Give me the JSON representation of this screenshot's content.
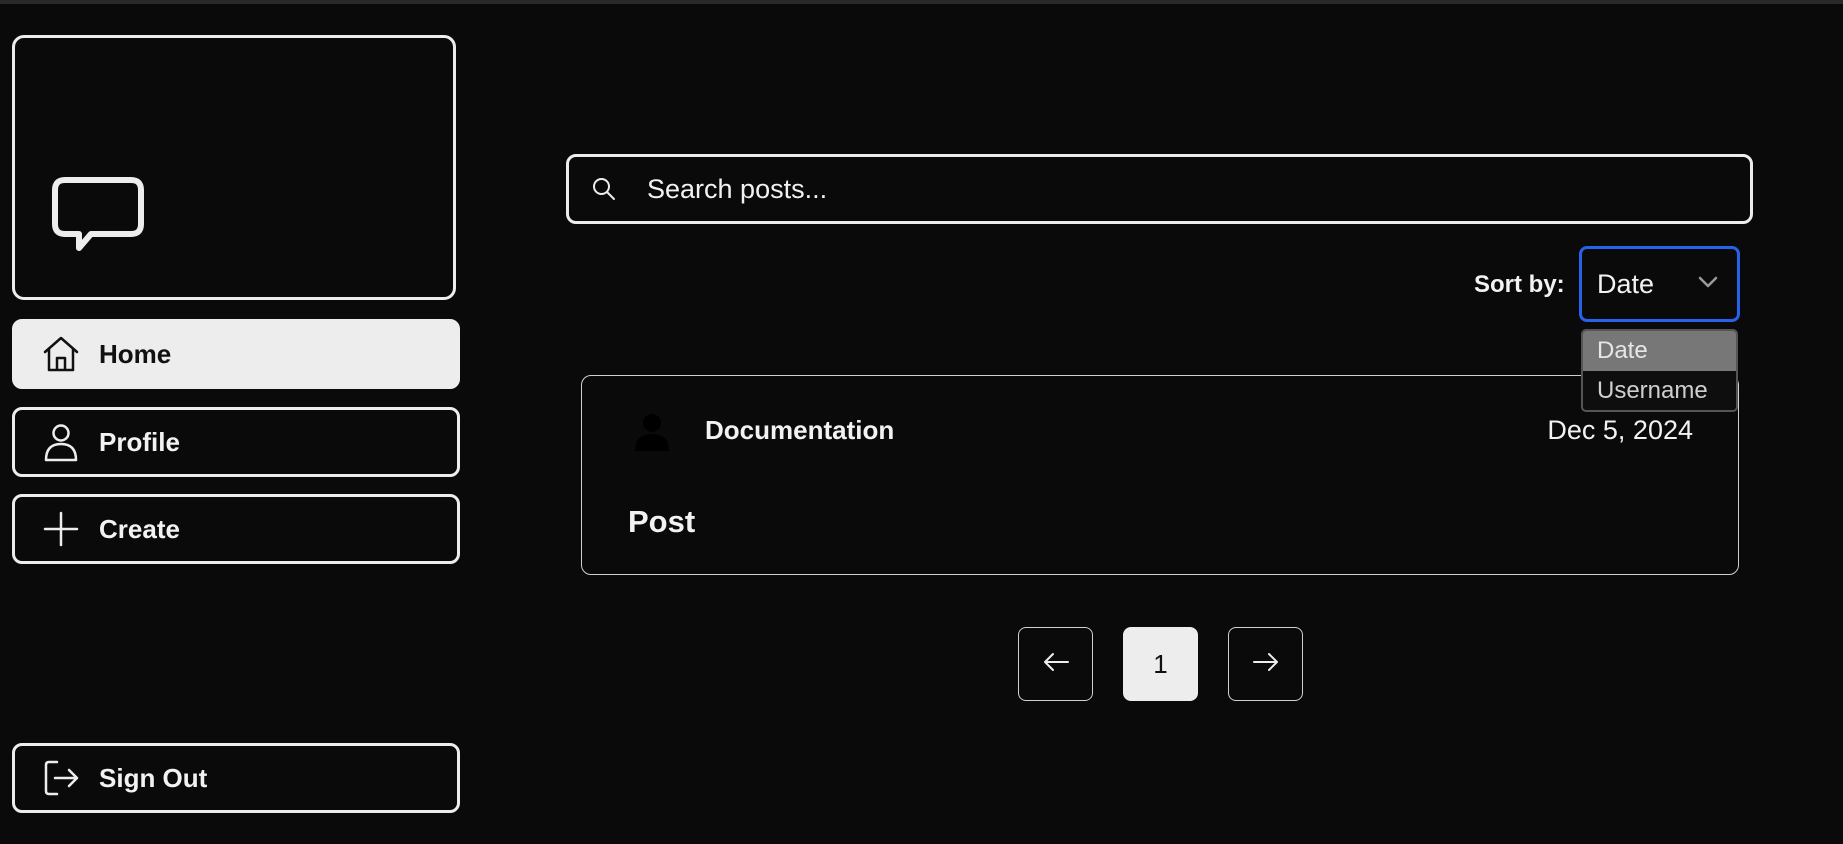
{
  "sidebar": {
    "logo": "speech-bubble-icon",
    "items": [
      {
        "label": "Home",
        "icon": "home-icon",
        "active": true
      },
      {
        "label": "Profile",
        "icon": "user-icon",
        "active": false
      },
      {
        "label": "Create",
        "icon": "plus-icon",
        "active": false
      }
    ],
    "signout": {
      "label": "Sign Out",
      "icon": "sign-out-icon"
    }
  },
  "search": {
    "placeholder": "Search posts...",
    "value": ""
  },
  "sort": {
    "label": "Sort by:",
    "selected": "Date",
    "options": [
      "Date",
      "Username"
    ]
  },
  "posts": [
    {
      "author": "Documentation",
      "date": "Dec 5, 2024",
      "title": "Post"
    }
  ],
  "pagination": {
    "current": "1"
  },
  "colors": {
    "background": "#0a0a0a",
    "foreground": "#ededed",
    "focus_ring": "#2563eb"
  }
}
